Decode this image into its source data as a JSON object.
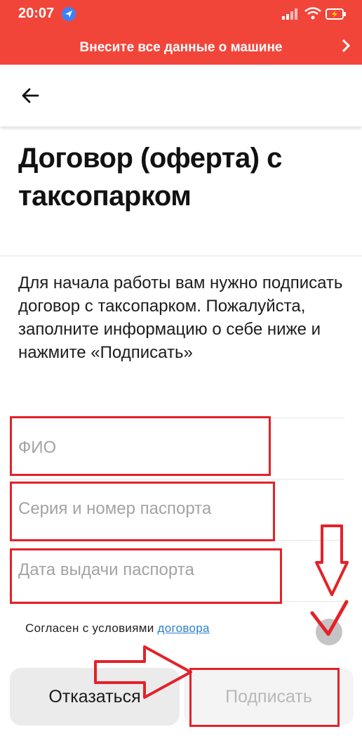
{
  "status_bar": {
    "time": "20:07"
  },
  "banner": {
    "text": "Внесите все данные о машине"
  },
  "page": {
    "title_line1": "Договор (оферта) с",
    "title_line2": "таксопарком",
    "description": "Для начала работы вам нужно подписать договор с таксопарком. Пожалуйста, заполните информацию о себе ниже и нажмите «Подписать»"
  },
  "form": {
    "full_name_placeholder": "ФИО",
    "passport_number_placeholder": "Серия и номер паспорта",
    "passport_date_placeholder": "Дата выдачи паспорта"
  },
  "agreement": {
    "text": "Согласен с условиями ",
    "link": "договора",
    "checked": false
  },
  "buttons": {
    "decline": "Отказаться",
    "sign": "Подписать"
  },
  "colors": {
    "accent": "#f2453a",
    "annotation": "#e32229",
    "link": "#2f7fcf"
  },
  "icons": [
    "location-arrow-icon",
    "signal-icon",
    "wifi-icon",
    "battery-icon",
    "chevron-right-icon",
    "back-arrow-icon",
    "down-arrow-annotation",
    "right-arrow-annotation",
    "check-annotation"
  ]
}
